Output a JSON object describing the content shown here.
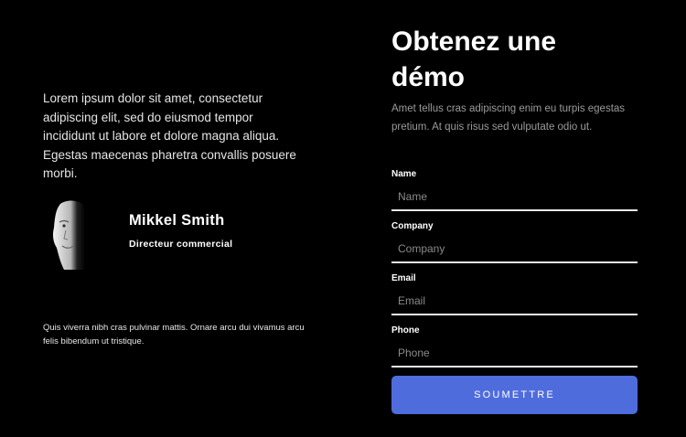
{
  "intro": {
    "text": "Lorem ipsum dolor sit amet, consectetur adipiscing elit, sed do eiusmod tempor incididunt ut labore et dolore magna aliqua. Egestas maecenas pharetra convallis posuere morbi."
  },
  "person": {
    "name": "Mikkel Smith",
    "role": "Directeur commercial"
  },
  "footnote": {
    "text": "Quis viverra nibh cras pulvinar mattis. Ornare arcu dui vivamus arcu felis bibendum ut tristique."
  },
  "form": {
    "title": "Obtenez une démo",
    "subtitle": "Amet tellus cras adipiscing enim eu turpis egestas pretium. At quis risus sed vulputate odio ut.",
    "fields": [
      {
        "label": "Name",
        "placeholder": "Name",
        "value": ""
      },
      {
        "label": "Company",
        "placeholder": "Company",
        "value": ""
      },
      {
        "label": "Email",
        "placeholder": "Email",
        "value": ""
      },
      {
        "label": "Phone",
        "placeholder": "Phone",
        "value": ""
      }
    ],
    "submit_label": "SOUMETTRE"
  },
  "colors": {
    "background": "#000000",
    "accent": "#4f6cdc",
    "muted_text": "#9a9a9a"
  }
}
